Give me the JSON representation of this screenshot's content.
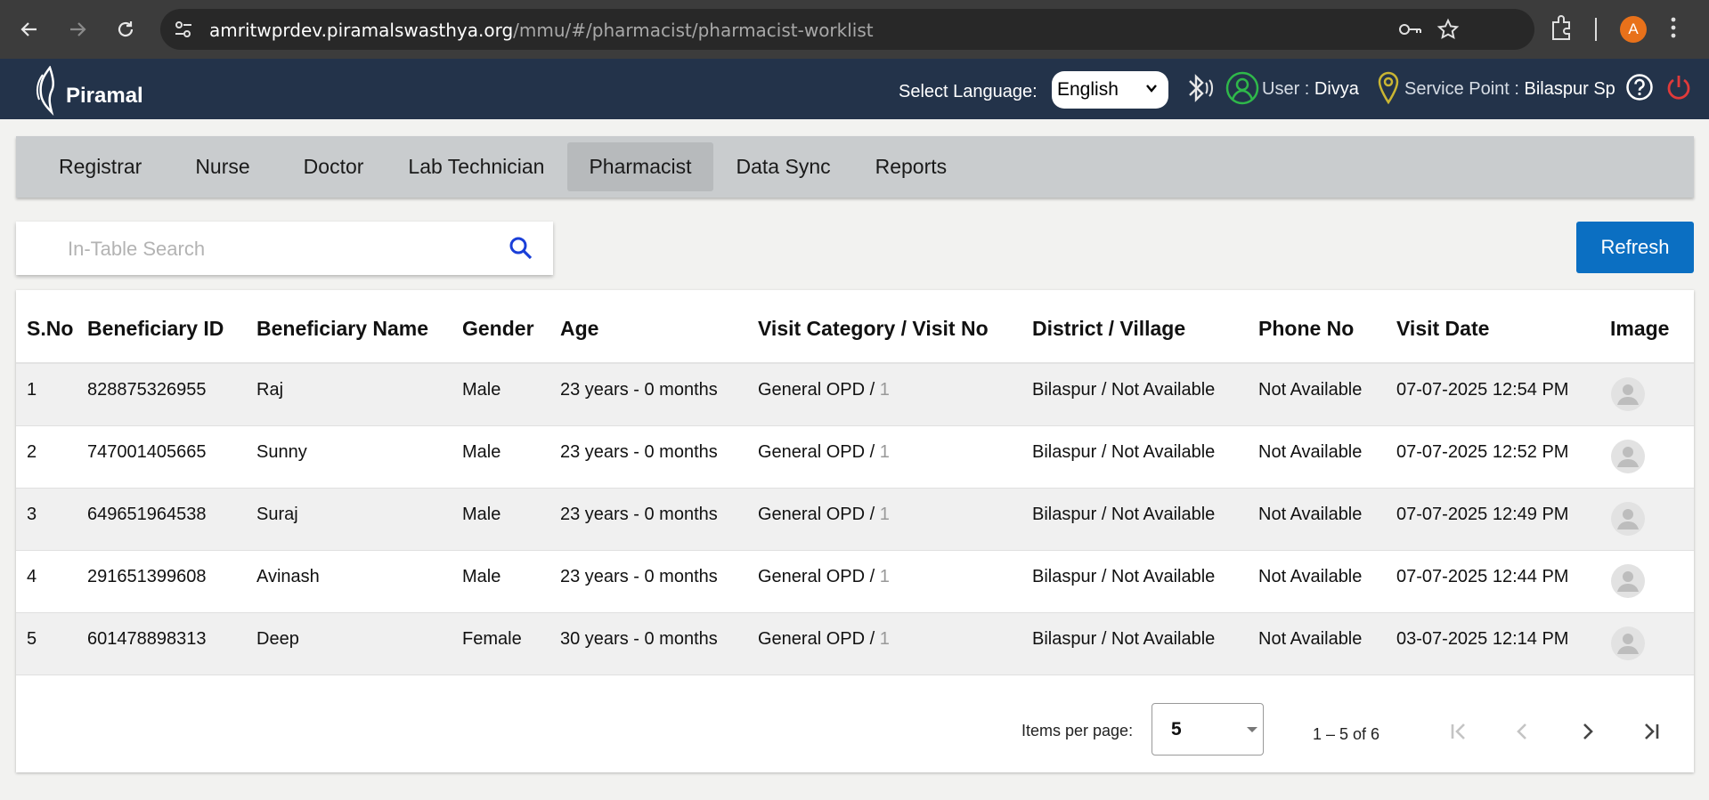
{
  "browser": {
    "url_host": "amritwprdev.piramalswasthya.org",
    "url_path": "/mmu/#/pharmacist/pharmacist-worklist",
    "profile_initial": "A"
  },
  "header": {
    "logo_text": "Piramal",
    "language_label": "Select Language:",
    "language_value": "English",
    "user_label": "User :",
    "user_name": "Divya",
    "service_point_label": "Service Point :",
    "service_point_value": "Bilaspur Sp"
  },
  "menu": {
    "items": [
      "Registrar",
      "Nurse",
      "Doctor",
      "Lab Technician",
      "Pharmacist",
      "Data Sync",
      "Reports"
    ],
    "active": "Pharmacist"
  },
  "search": {
    "placeholder": "In-Table Search"
  },
  "refresh_label": "Refresh",
  "table": {
    "columns": [
      "S.No",
      "Beneficiary ID",
      "Beneficiary Name",
      "Gender",
      "Age",
      "Visit Category / Visit No",
      "District / Village",
      "Phone No",
      "Visit Date",
      "Image"
    ],
    "rows": [
      {
        "sno": "1",
        "id": "828875326955",
        "name": "Raj",
        "gender": "Male",
        "age": "23 years - 0 months",
        "category": "General OPD /",
        "visit_no": "1",
        "district": "Bilaspur / Not Available",
        "phone": "Not Available",
        "date": "07-07-2025 12:54 PM"
      },
      {
        "sno": "2",
        "id": "747001405665",
        "name": "Sunny",
        "gender": "Male",
        "age": "23 years - 0 months",
        "category": "General OPD /",
        "visit_no": "1",
        "district": "Bilaspur / Not Available",
        "phone": "Not Available",
        "date": "07-07-2025 12:52 PM"
      },
      {
        "sno": "3",
        "id": "649651964538",
        "name": "Suraj",
        "gender": "Male",
        "age": "23 years - 0 months",
        "category": "General OPD /",
        "visit_no": "1",
        "district": "Bilaspur / Not Available",
        "phone": "Not Available",
        "date": "07-07-2025 12:49 PM"
      },
      {
        "sno": "4",
        "id": "291651399608",
        "name": "Avinash",
        "gender": "Male",
        "age": "23 years - 0 months",
        "category": "General OPD /",
        "visit_no": "1",
        "district": "Bilaspur / Not Available",
        "phone": "Not Available",
        "date": "07-07-2025 12:44 PM"
      },
      {
        "sno": "5",
        "id": "601478898313",
        "name": "Deep",
        "gender": "Female",
        "age": "30 years - 0 months",
        "category": "General OPD /",
        "visit_no": "1",
        "district": "Bilaspur / Not Available",
        "phone": "Not Available",
        "date": "03-07-2025 12:14 PM"
      }
    ]
  },
  "pagination": {
    "items_per_page_label": "Items per page:",
    "items_per_page_value": "5",
    "range_label": "1 – 5 of 6"
  },
  "colors": {
    "header_bg": "#23334a",
    "menu_bg": "#c9ccce",
    "accent_blue": "#0b6fc2",
    "user_icon": "#2fb84a",
    "pin_icon": "#c9b533",
    "power_icon": "#e03a3a"
  }
}
